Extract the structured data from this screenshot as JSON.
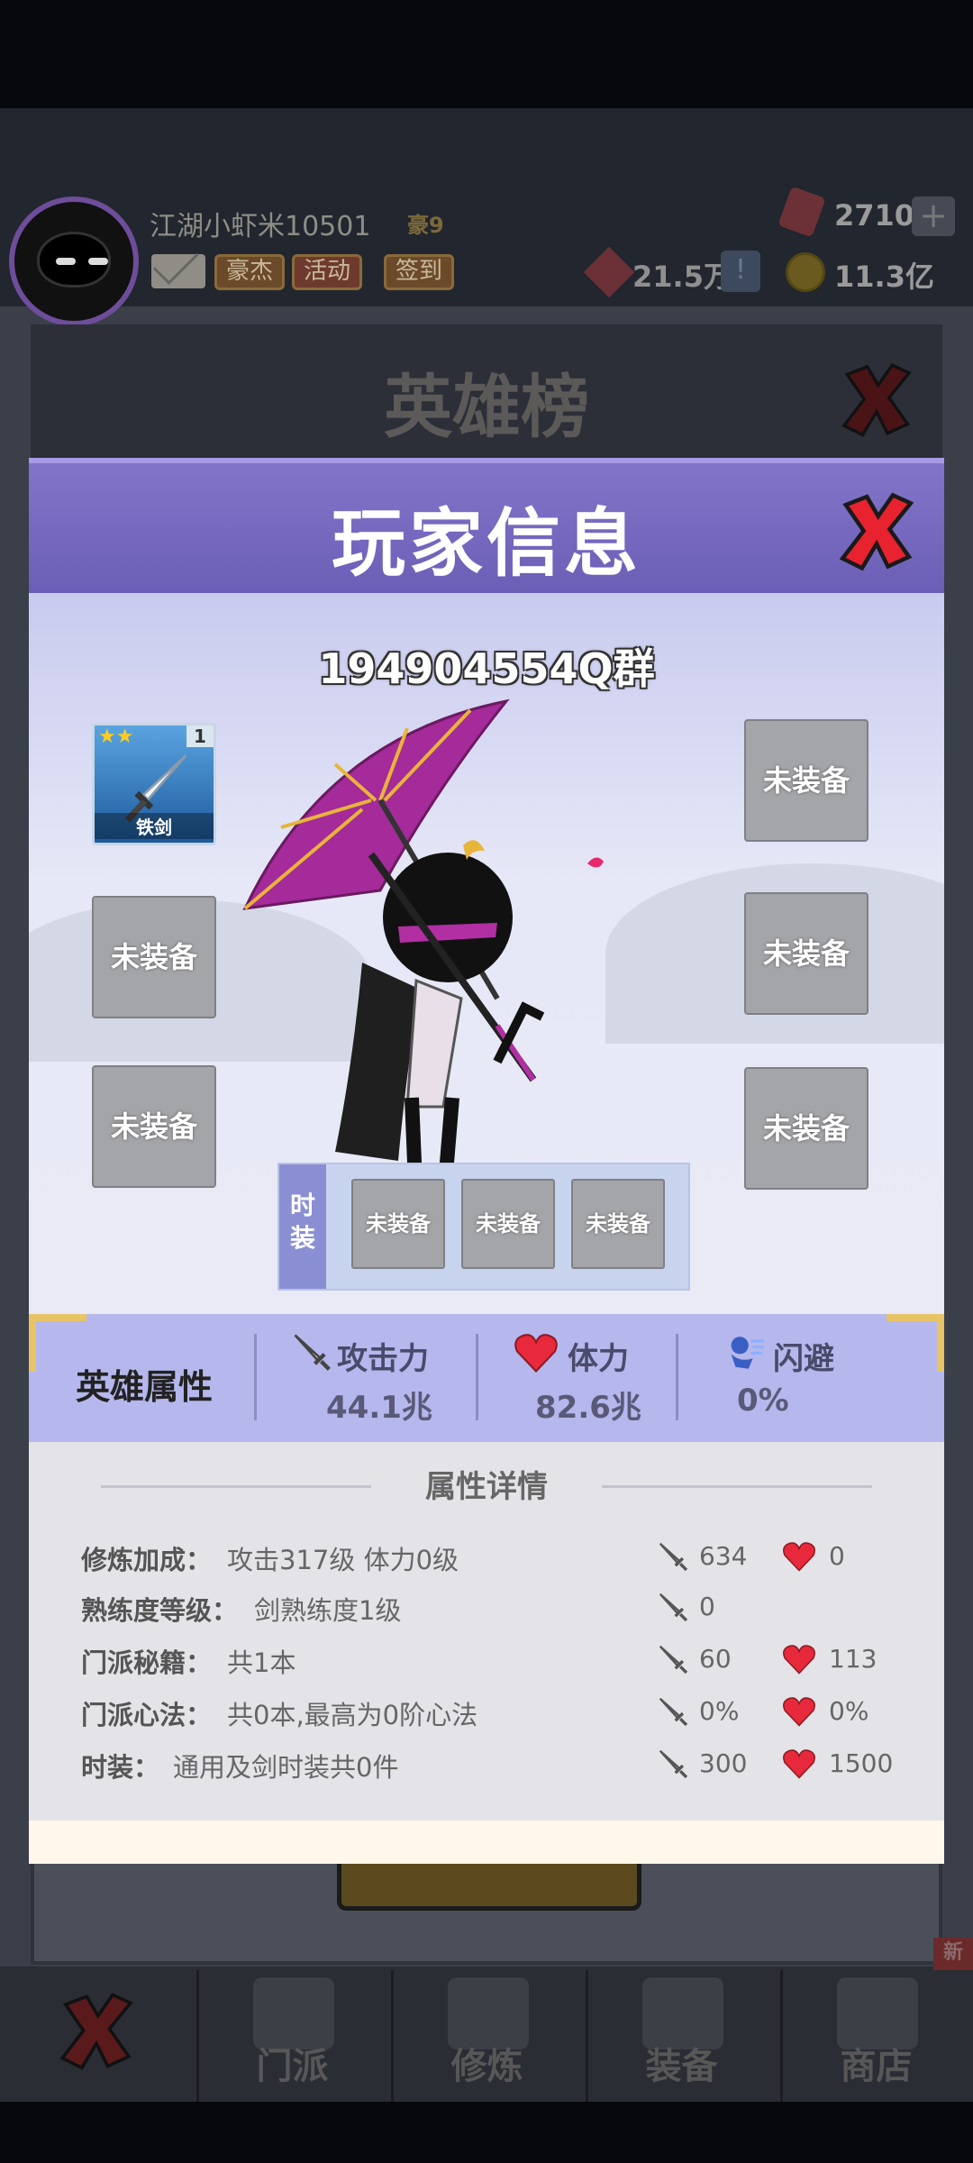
{
  "top_bar": {
    "player_name": "江湖小虾米10501",
    "player_tag": "豪9",
    "buttons": [
      "豪杰",
      "活动",
      "签到"
    ],
    "gems": "2710",
    "plus": "+",
    "power": "21.5万",
    "info": "!",
    "coins": "11.3亿"
  },
  "rank_panel": {
    "title": "英雄榜"
  },
  "modal": {
    "title": "玩家信息",
    "player_id": "194904554Q群",
    "weapon": {
      "name": "铁剑",
      "stars": "★★",
      "level": "1"
    },
    "empty_slot": "未装备",
    "fashion_label": "时装",
    "attributes": {
      "title": "英雄属性",
      "attack_label": "攻击力",
      "attack_value": "44.1兆",
      "hp_label": "体力",
      "hp_value": "82.6兆",
      "dodge_label": "闪避",
      "dodge_value": "0%"
    },
    "details": {
      "title": "属性详情",
      "rows": [
        {
          "label": "修炼加成：",
          "value": "攻击317级 体力0级",
          "atk": "634",
          "hp": "0"
        },
        {
          "label": "熟练度等级：",
          "value": "剑熟练度1级",
          "atk": "0",
          "hp": ""
        },
        {
          "label": "门派秘籍：",
          "value": "共1本",
          "atk": "60",
          "hp": "113"
        },
        {
          "label": "门派心法：",
          "value": "共0本,最高为0阶心法",
          "atk": "0%",
          "hp": "0%"
        },
        {
          "label": "时装：",
          "value": "通用及剑时装共0件",
          "atk": "300",
          "hp": "1500"
        }
      ]
    }
  },
  "bottom_nav": {
    "tabs": [
      "门派",
      "修炼",
      "装备",
      "商店"
    ],
    "new_badge": "新"
  },
  "colors": {
    "header_purple": "#6b5eb6",
    "attr_bar": "#b5b7ed",
    "slot_gray": "#a4a5a9",
    "heart_red": "#e8293b"
  }
}
